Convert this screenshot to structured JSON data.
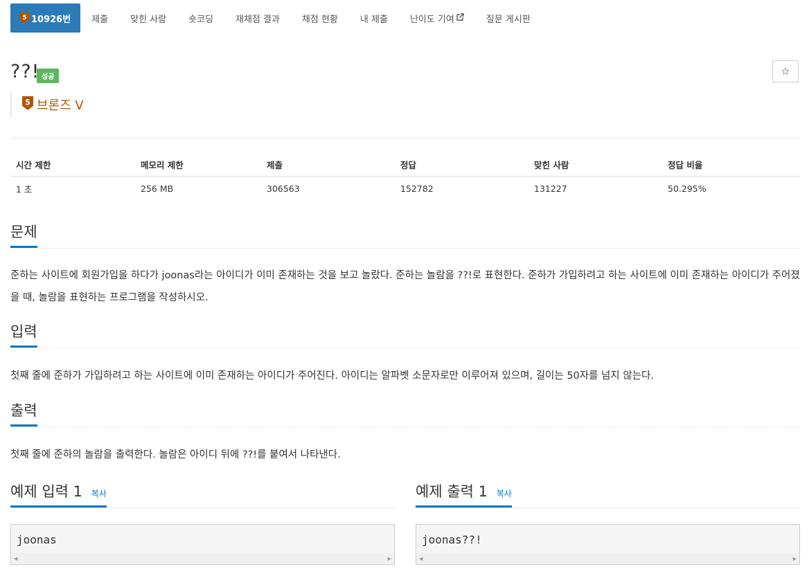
{
  "nav": {
    "problem_tab": "10926번",
    "tier_level": "5",
    "items": [
      "제출",
      "맞힌 사람",
      "숏코딩",
      "재채점 결과",
      "채점 현황",
      "내 제출",
      "난이도 기여",
      "질문 게시판"
    ]
  },
  "problem": {
    "title": "??!",
    "result_badge": "성공",
    "tier": "브론즈 V",
    "tier_level": "5"
  },
  "info_table": {
    "headers": [
      "시간 제한",
      "메모리 제한",
      "제출",
      "정답",
      "맞힌 사람",
      "정답 비율"
    ],
    "values": [
      "1 초",
      "256 MB",
      "306563",
      "152782",
      "131227",
      "50.295%"
    ]
  },
  "sections": {
    "problem": {
      "title": "문제",
      "text": "준하는 사이트에 회원가입을 하다가 joonas라는 아이디가 이미 존재하는 것을 보고 놀랐다. 준하는 놀람을 ??!로 표현한다. 준하가 가입하려고 하는 사이트에 이미 존재하는 아이디가 주어졌을 때, 놀람을 표현하는 프로그램을 작성하시오."
    },
    "input": {
      "title": "입력",
      "text": "첫째 줄에 준하가 가입하려고 하는 사이트에 이미 존재하는 아이디가 주어진다. 아이디는 알파벳 소문자로만 이루어져 있으며, 길이는 50자를 넘지 않는다."
    },
    "output": {
      "title": "출력",
      "text": "첫째 줄에 준하의 놀람을 출력한다. 놀람은 아이디 뒤에 ??!를 붙여서 나타낸다."
    }
  },
  "examples": {
    "input": {
      "title": "예제 입력 1",
      "copy": "복사",
      "content": "joonas"
    },
    "output": {
      "title": "예제 출력 1",
      "copy": "복사",
      "content": "joonas??!"
    }
  },
  "colors": {
    "primary": "#2b7bb9",
    "success": "#5cb85c",
    "bronze": "#ad5600",
    "link": "#0076c0"
  }
}
